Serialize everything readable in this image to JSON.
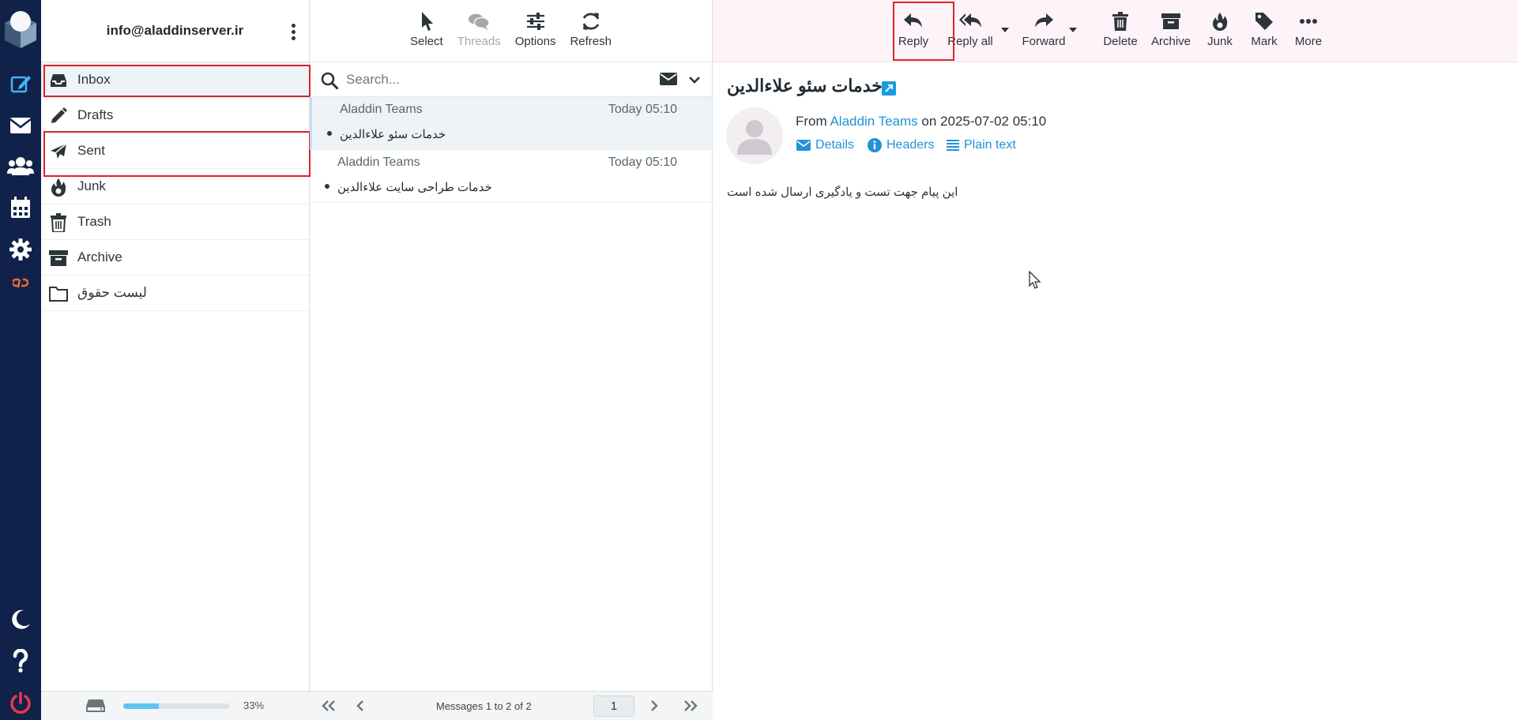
{
  "account": {
    "email": "info@aladdinserver.ir"
  },
  "folders": [
    {
      "name": "Inbox",
      "icon": "inbox-icon",
      "selected": true,
      "highlighted": true
    },
    {
      "name": "Drafts",
      "icon": "pencil-icon"
    },
    {
      "name": "Sent",
      "icon": "paper-plane-icon",
      "highlighted": true
    },
    {
      "name": "Junk",
      "icon": "fire-icon"
    },
    {
      "name": "Trash",
      "icon": "trash-icon"
    },
    {
      "name": "Archive",
      "icon": "archive-box-icon"
    },
    {
      "name": "لیست حقوق",
      "icon": "folder-icon"
    }
  ],
  "quota": {
    "percent_label": "33%",
    "used_fraction": 0.33
  },
  "list_toolbar": {
    "select": "Select",
    "threads": "Threads",
    "options": "Options",
    "refresh": "Refresh"
  },
  "search": {
    "placeholder": "Search..."
  },
  "messages": [
    {
      "from": "Aladdin Teams",
      "date": "Today 05:10",
      "subject": "خدمات سئو علاءالدین",
      "selected": true
    },
    {
      "from": "Aladdin Teams",
      "date": "Today 05:10",
      "subject": "خدمات طراحی سایت علاءالدین"
    }
  ],
  "list_footer": {
    "count": "Messages 1 to 2 of 2",
    "page": "1"
  },
  "message_toolbar": {
    "reply": "Reply",
    "reply_all": "Reply all",
    "forward": "Forward",
    "delete": "Delete",
    "archive": "Archive",
    "junk": "Junk",
    "mark": "Mark",
    "more": "More"
  },
  "message": {
    "subject": "خدمات سئو علاءالدین",
    "from_prefix": "From",
    "from_name": "Aladdin Teams",
    "on_date": "on 2025-07-02 05:10",
    "details": "Details",
    "headers": "Headers",
    "plain_text": "Plain text",
    "body": "این پیام جهت تست و یادگیری ارسال شده است"
  },
  "colors": {
    "nav_bg": "#10224a",
    "accent": "#2292d6",
    "highlight_box": "#d9252b",
    "toolbar_bg": "#fdf3f8"
  }
}
